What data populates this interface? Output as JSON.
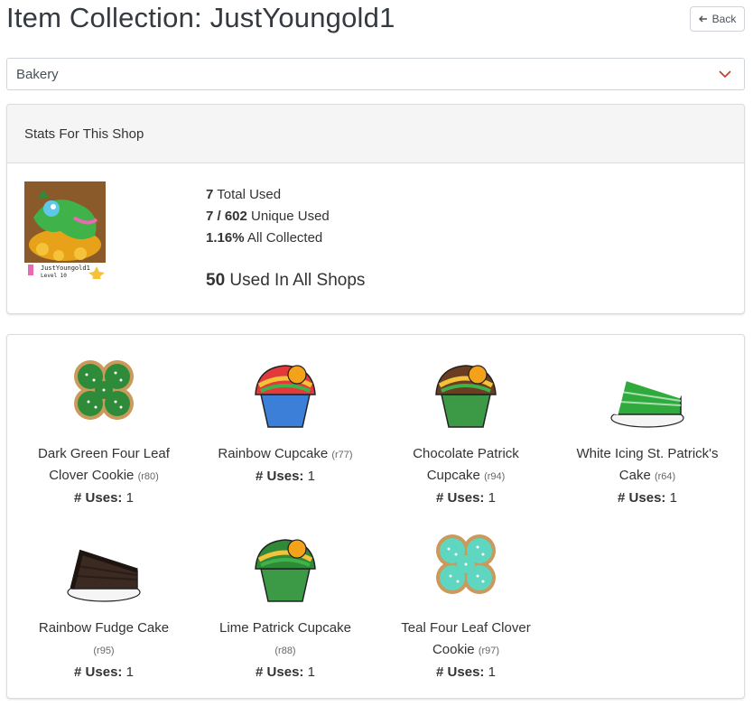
{
  "page": {
    "title": "Item Collection: JustYoungold1",
    "back_label": "Back"
  },
  "shop_select": {
    "selected": "Bakery"
  },
  "stats": {
    "header": "Stats For This Shop",
    "avatar_caption": "JustYoungold1",
    "avatar_level": "Level 10",
    "total_used_value": "7",
    "total_used_label": "Total Used",
    "unique_used_value": "7 / 602",
    "unique_used_label": "Unique Used",
    "collected_value": "1.16%",
    "collected_label": "All Collected",
    "all_shops_value": "50",
    "all_shops_label": "Used In All Shops"
  },
  "uses_label": "# Uses:",
  "items": [
    {
      "name": "Dark Green Four Leaf Clover Cookie",
      "rarity": "(r80)",
      "uses": "1",
      "icon": "cookie-icon",
      "colors": {
        "main": "#2e8b3a",
        "edge": "#c99a5b"
      }
    },
    {
      "name": "Rainbow Cupcake",
      "rarity": "(r77)",
      "uses": "1",
      "icon": "cupcake-icon",
      "colors": {
        "main": "#3b7fd9",
        "edge": "#e23a3a"
      }
    },
    {
      "name": "Chocolate Patrick Cupcake",
      "rarity": "(r94)",
      "uses": "1",
      "icon": "cupcake-icon",
      "colors": {
        "main": "#3c9a46",
        "edge": "#6b3e22"
      }
    },
    {
      "name": "White Icing St. Patrick's Cake",
      "rarity": "(r64)",
      "uses": "1",
      "icon": "cake-slice-icon",
      "colors": {
        "main": "#2faa3c",
        "edge": "#ffffff"
      }
    },
    {
      "name": "Rainbow Fudge Cake",
      "rarity": "(r95)",
      "uses": "1",
      "icon": "cake-slice-icon",
      "colors": {
        "main": "#3a2a22",
        "edge": "#1f1510"
      }
    },
    {
      "name": "Lime Patrick Cupcake",
      "rarity": "(r88)",
      "uses": "1",
      "icon": "cupcake-icon",
      "colors": {
        "main": "#3c9a46",
        "edge": "#2f8a38"
      }
    },
    {
      "name": "Teal Four Leaf Clover Cookie",
      "rarity": "(r97)",
      "uses": "1",
      "icon": "cookie-icon",
      "colors": {
        "main": "#5fd6c0",
        "edge": "#c99a5b"
      }
    }
  ]
}
